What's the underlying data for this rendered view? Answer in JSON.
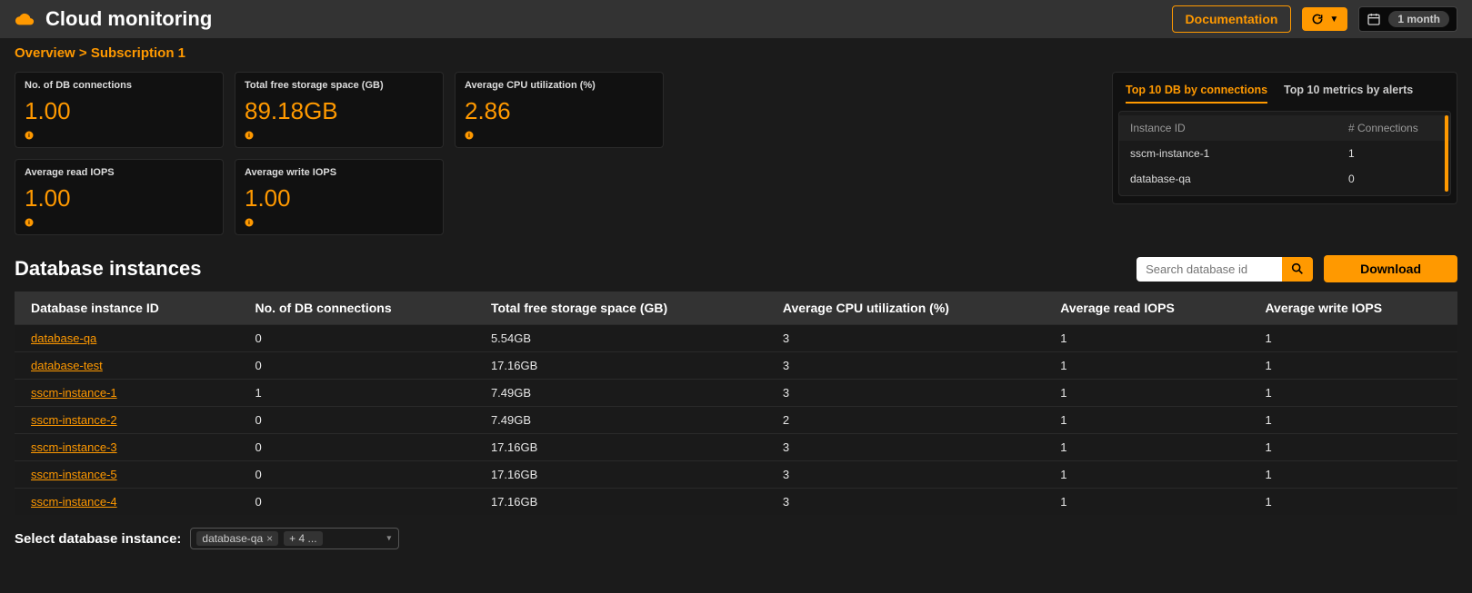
{
  "header": {
    "app_title": "Cloud monitoring",
    "documentation_label": "Documentation",
    "time_range_label": "1 month"
  },
  "breadcrumb": {
    "overview_label": "Overview",
    "separator": ">",
    "current_label": "Subscription 1"
  },
  "metrics": [
    {
      "label": "No. of DB connections",
      "value": "1.00"
    },
    {
      "label": "Total free storage space (GB)",
      "value": "89.18GB"
    },
    {
      "label": "Average CPU utilization (%)",
      "value": "2.86"
    },
    {
      "label": "Average read IOPS",
      "value": "1.00"
    },
    {
      "label": "Average write IOPS",
      "value": "1.00"
    }
  ],
  "side_panel": {
    "tabs": [
      {
        "label": "Top 10 DB by connections",
        "active": true
      },
      {
        "label": "Top 10 metrics by alerts",
        "active": false
      }
    ],
    "columns": {
      "id": "Instance ID",
      "conn": "# Connections"
    },
    "rows": [
      {
        "id": "sscm-instance-1",
        "conn": "1"
      },
      {
        "id": "database-qa",
        "conn": "0"
      }
    ]
  },
  "instances_section": {
    "title": "Database instances",
    "search_placeholder": "Search database id",
    "download_label": "Download",
    "columns": [
      "Database instance ID",
      "No. of DB connections",
      "Total free storage space (GB)",
      "Average CPU utilization (%)",
      "Average read IOPS",
      "Average write IOPS"
    ],
    "rows": [
      {
        "id": "database-qa",
        "conn": "0",
        "storage": "5.54GB",
        "cpu": "3",
        "read": "1",
        "write": "1"
      },
      {
        "id": "database-test",
        "conn": "0",
        "storage": "17.16GB",
        "cpu": "3",
        "read": "1",
        "write": "1"
      },
      {
        "id": "sscm-instance-1",
        "conn": "1",
        "storage": "7.49GB",
        "cpu": "3",
        "read": "1",
        "write": "1"
      },
      {
        "id": "sscm-instance-2",
        "conn": "0",
        "storage": "7.49GB",
        "cpu": "2",
        "read": "1",
        "write": "1"
      },
      {
        "id": "sscm-instance-3",
        "conn": "0",
        "storage": "17.16GB",
        "cpu": "3",
        "read": "1",
        "write": "1"
      },
      {
        "id": "sscm-instance-5",
        "conn": "0",
        "storage": "17.16GB",
        "cpu": "3",
        "read": "1",
        "write": "1"
      },
      {
        "id": "sscm-instance-4",
        "conn": "0",
        "storage": "17.16GB",
        "cpu": "3",
        "read": "1",
        "write": "1"
      }
    ]
  },
  "footer": {
    "label": "Select database instance:",
    "chip": "database-qa",
    "more": "+ 4 ..."
  },
  "colors": {
    "accent": "#ff9900"
  }
}
